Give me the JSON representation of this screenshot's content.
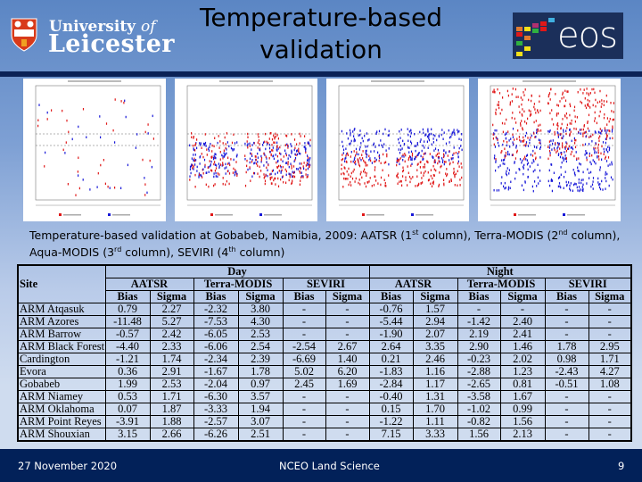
{
  "header": {
    "title_line1": "Temperature-based",
    "title_line2": "validation",
    "left_logo": {
      "line1": "University",
      "line1_suffix": "of",
      "line2": "Leicester"
    },
    "right_logo": {
      "text": "eos"
    }
  },
  "figures": [
    {
      "label": "AATSR",
      "series": [
        {
          "name": "Day",
          "color": "#e01818"
        },
        {
          "name": "Night",
          "color": "#1818d8"
        }
      ]
    },
    {
      "label": "Terra-MODIS",
      "series": [
        {
          "name": "Day",
          "color": "#e01818"
        },
        {
          "name": "Night",
          "color": "#1818d8"
        }
      ]
    },
    {
      "label": "Aqua-MODIS",
      "series": [
        {
          "name": "Day",
          "color": "#e01818"
        },
        {
          "name": "Night",
          "color": "#1818d8"
        }
      ]
    },
    {
      "label": "SEVIRI",
      "series": [
        {
          "name": "Day",
          "color": "#e01818"
        },
        {
          "name": "Night",
          "color": "#1818d8"
        }
      ]
    }
  ],
  "caption": {
    "part1": "Temperature-based validation at Gobabeb, Namibia, 2009: AATSR (1",
    "sup1": "st",
    "part2": " column), Terra-MODIS (2",
    "sup2": "nd",
    "part3": " column), Aqua-MODIS (3",
    "sup3": "rd",
    "part4": " column), SEVIRI (4",
    "sup4": "th",
    "part5": " column)"
  },
  "table": {
    "site_header": "Site",
    "day_header": "Day",
    "night_header": "Night",
    "sensors": [
      "AATSR",
      "Terra-MODIS",
      "SEVIRI"
    ],
    "bias_label": "Bias",
    "sigma_label": "Sigma",
    "rows": [
      {
        "site": "ARM Atqasuk",
        "values": [
          "0.79",
          "2.27",
          "-2.32",
          "3.80",
          "-",
          "-",
          "-0.76",
          "1.57",
          "-",
          "-",
          "-",
          "-"
        ]
      },
      {
        "site": "ARM Azores",
        "values": [
          "-11.48",
          "5.27",
          "-7.53",
          "4.30",
          "-",
          "-",
          "-5.44",
          "2.94",
          "-1.42",
          "2.40",
          "-",
          "-"
        ]
      },
      {
        "site": "ARM Barrow",
        "values": [
          "-0.57",
          "2.42",
          "-6.05",
          "2.53",
          "-",
          "-",
          "-1.90",
          "2.07",
          "2.19",
          "2.41",
          "-",
          "-"
        ]
      },
      {
        "site": "ARM Black Forest",
        "values": [
          "-4.40",
          "2.33",
          "-6.06",
          "2.54",
          "-2.54",
          "2.67",
          "2.64",
          "3.35",
          "2.90",
          "1.46",
          "1.78",
          "2.95"
        ]
      },
      {
        "site": "Cardington",
        "values": [
          "-1.21",
          "1.74",
          "-2.34",
          "2.39",
          "-6.69",
          "1.40",
          "0.21",
          "2.46",
          "-0.23",
          "2.02",
          "0.98",
          "1.71"
        ]
      },
      {
        "site": "Evora",
        "values": [
          "0.36",
          "2.91",
          "-1.67",
          "1.78",
          "5.02",
          "6.20",
          "-1.83",
          "1.16",
          "-2.88",
          "1.23",
          "-2.43",
          "4.27"
        ]
      },
      {
        "site": "Gobabeb",
        "values": [
          "1.99",
          "2.53",
          "-2.04",
          "0.97",
          "2.45",
          "1.69",
          "-2.84",
          "1.17",
          "-2.65",
          "0.81",
          "-0.51",
          "1.08"
        ]
      },
      {
        "site": "ARM Niamey",
        "values": [
          "0.53",
          "1.71",
          "-6.30",
          "3.57",
          "-",
          "-",
          "-0.40",
          "1.31",
          "-3.58",
          "1.67",
          "-",
          "-"
        ]
      },
      {
        "site": "ARM Oklahoma",
        "values": [
          "0.07",
          "1.87",
          "-3.33",
          "1.94",
          "-",
          "-",
          "0.15",
          "1.70",
          "-1.02",
          "0.99",
          "-",
          "-"
        ]
      },
      {
        "site": "ARM Point Reyes",
        "values": [
          "-3.91",
          "1.88",
          "-2.57",
          "3.07",
          "-",
          "-",
          "-1.22",
          "1.11",
          "-0.82",
          "1.56",
          "-",
          "-"
        ]
      },
      {
        "site": "ARM Shouxian",
        "values": [
          "3.15",
          "2.66",
          "-6.26",
          "2.51",
          "-",
          "-",
          "7.15",
          "3.33",
          "1.56",
          "2.13",
          "-",
          "-"
        ]
      }
    ]
  },
  "footer": {
    "date": "27 November 2020",
    "center": "NCEO Land Science",
    "page": "9"
  }
}
